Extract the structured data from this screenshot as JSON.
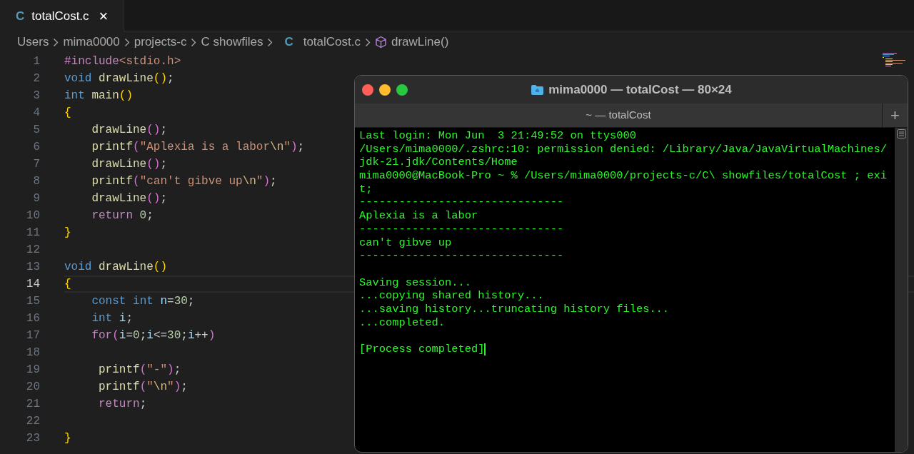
{
  "editor_tabs": [
    {
      "icon_letter": "C",
      "label": "totalCost.c",
      "close": "×",
      "selected": true
    }
  ],
  "breadcrumbs": [
    {
      "label": "Users"
    },
    {
      "label": "mima0000"
    },
    {
      "label": "projects-c"
    },
    {
      "label": "C showfiles"
    },
    {
      "label": "totalCost.c",
      "kind": "file",
      "icon_letter": "C"
    },
    {
      "label": "drawLine()",
      "kind": "symbol"
    }
  ],
  "code_lines": [
    {
      "number": "1",
      "selected": false,
      "tokens": [
        {
          "text": "#include",
          "kind": "control"
        },
        {
          "text": "<stdio.h>",
          "kind": "string"
        }
      ]
    },
    {
      "number": "2",
      "selected": false,
      "tokens": [
        {
          "text": "void",
          "kind": "keyword"
        },
        {
          "text": " drawLine",
          "kind": "function"
        },
        {
          "text": "()",
          "kind": "bracket1"
        },
        {
          "text": ";",
          "kind": "plain"
        }
      ]
    },
    {
      "number": "3",
      "selected": false,
      "tokens": [
        {
          "text": "int",
          "kind": "keyword"
        },
        {
          "text": " main",
          "kind": "function"
        },
        {
          "text": "()",
          "kind": "bracket1"
        }
      ]
    },
    {
      "number": "4",
      "selected": false,
      "tokens": [
        {
          "text": "{",
          "kind": "bracket1"
        }
      ]
    },
    {
      "number": "5",
      "selected": false,
      "tokens": [
        {
          "text": "    drawLine",
          "kind": "function"
        },
        {
          "text": "()",
          "kind": "bracket2"
        },
        {
          "text": ";",
          "kind": "plain"
        }
      ]
    },
    {
      "number": "6",
      "selected": false,
      "tokens": [
        {
          "text": "    printf",
          "kind": "function"
        },
        {
          "text": "(",
          "kind": "bracket2"
        },
        {
          "text": "\"Aplexia is a labor",
          "kind": "string"
        },
        {
          "text": "\\n",
          "kind": "escape"
        },
        {
          "text": "\"",
          "kind": "string"
        },
        {
          "text": ")",
          "kind": "bracket2"
        },
        {
          "text": ";",
          "kind": "plain"
        }
      ]
    },
    {
      "number": "7",
      "selected": false,
      "tokens": [
        {
          "text": "    drawLine",
          "kind": "function"
        },
        {
          "text": "()",
          "kind": "bracket2"
        },
        {
          "text": ";",
          "kind": "plain"
        }
      ]
    },
    {
      "number": "8",
      "selected": false,
      "tokens": [
        {
          "text": "    printf",
          "kind": "function"
        },
        {
          "text": "(",
          "kind": "bracket2"
        },
        {
          "text": "\"can't gibve up",
          "kind": "string"
        },
        {
          "text": "\\n",
          "kind": "escape"
        },
        {
          "text": "\"",
          "kind": "string"
        },
        {
          "text": ")",
          "kind": "bracket2"
        },
        {
          "text": ";",
          "kind": "plain"
        }
      ]
    },
    {
      "number": "9",
      "selected": false,
      "tokens": [
        {
          "text": "    drawLine",
          "kind": "function"
        },
        {
          "text": "()",
          "kind": "bracket2"
        },
        {
          "text": ";",
          "kind": "plain"
        }
      ]
    },
    {
      "number": "10",
      "selected": false,
      "tokens": [
        {
          "text": "    return",
          "kind": "control"
        },
        {
          "text": " 0",
          "kind": "number"
        },
        {
          "text": ";",
          "kind": "plain"
        }
      ]
    },
    {
      "number": "11",
      "selected": false,
      "tokens": [
        {
          "text": "}",
          "kind": "bracket1"
        }
      ]
    },
    {
      "number": "12",
      "selected": false
    },
    {
      "number": "13",
      "selected": false,
      "tokens": [
        {
          "text": "void",
          "kind": "keyword"
        },
        {
          "text": " drawLine",
          "kind": "function"
        },
        {
          "text": "()",
          "kind": "bracket1"
        }
      ]
    },
    {
      "number": "14",
      "selected": true,
      "tokens": [
        {
          "text": "{",
          "kind": "bracket1"
        }
      ]
    },
    {
      "number": "15",
      "selected": false,
      "tokens": [
        {
          "text": "    const",
          "kind": "keyword"
        },
        {
          "text": " int",
          "kind": "keyword"
        },
        {
          "text": " n",
          "kind": "variable"
        },
        {
          "text": "=",
          "kind": "plain"
        },
        {
          "text": "30",
          "kind": "number"
        },
        {
          "text": ";",
          "kind": "plain"
        }
      ]
    },
    {
      "number": "16",
      "selected": false,
      "tokens": [
        {
          "text": "    int",
          "kind": "keyword"
        },
        {
          "text": " i",
          "kind": "variable"
        },
        {
          "text": ";",
          "kind": "plain"
        }
      ]
    },
    {
      "number": "17",
      "selected": false,
      "tokens": [
        {
          "text": "    for",
          "kind": "control"
        },
        {
          "text": "(",
          "kind": "bracket2"
        },
        {
          "text": "i",
          "kind": "variable"
        },
        {
          "text": "=",
          "kind": "plain"
        },
        {
          "text": "0",
          "kind": "number"
        },
        {
          "text": ";",
          "kind": "plain"
        },
        {
          "text": "i",
          "kind": "variable"
        },
        {
          "text": "<=",
          "kind": "plain"
        },
        {
          "text": "30",
          "kind": "number"
        },
        {
          "text": ";",
          "kind": "plain"
        },
        {
          "text": "i",
          "kind": "variable"
        },
        {
          "text": "++",
          "kind": "plain"
        },
        {
          "text": ")",
          "kind": "bracket2"
        }
      ]
    },
    {
      "number": "18",
      "selected": false
    },
    {
      "number": "19",
      "selected": false,
      "tokens": [
        {
          "text": "     printf",
          "kind": "function"
        },
        {
          "text": "(",
          "kind": "bracket2"
        },
        {
          "text": "\"-\"",
          "kind": "string"
        },
        {
          "text": ")",
          "kind": "bracket2"
        },
        {
          "text": ";",
          "kind": "plain"
        }
      ]
    },
    {
      "number": "20",
      "selected": false,
      "tokens": [
        {
          "text": "     printf",
          "kind": "function"
        },
        {
          "text": "(",
          "kind": "bracket2"
        },
        {
          "text": "\"",
          "kind": "string"
        },
        {
          "text": "\\n",
          "kind": "escape"
        },
        {
          "text": "\"",
          "kind": "string"
        },
        {
          "text": ")",
          "kind": "bracket2"
        },
        {
          "text": ";",
          "kind": "plain"
        }
      ]
    },
    {
      "number": "21",
      "selected": false,
      "tokens": [
        {
          "text": "     return",
          "kind": "control"
        },
        {
          "text": ";",
          "kind": "plain"
        }
      ]
    },
    {
      "number": "22",
      "selected": false
    },
    {
      "number": "23",
      "selected": false,
      "tokens": [
        {
          "text": "}",
          "kind": "bracket1"
        }
      ]
    }
  ],
  "terminal": {
    "title": "mima0000 — totalCost — 80×24",
    "tab": "~ — totalCost",
    "new_tab": "+",
    "output_blocks": [
      [
        "Last login: Mon Jun  3 21:49:52 on ttys000",
        "/Users/mima0000/.zshrc:10: permission denied: /Library/Java/JavaVirtualMachines/",
        "jdk-21.jdk/Contents/Home",
        "mima0000@MacBook-Pro ~ % /Users/mima0000/projects-c/C\\ showfiles/totalCost ; exi",
        "t;",
        "-------------------------------",
        "Aplexia is a labor",
        "-------------------------------",
        "can't gibve up",
        "-------------------------------"
      ],
      [
        "Saving session...",
        "...copying shared history...",
        "...saving history...truncating history files...",
        "...completed."
      ],
      [
        "[Process completed]"
      ]
    ]
  }
}
